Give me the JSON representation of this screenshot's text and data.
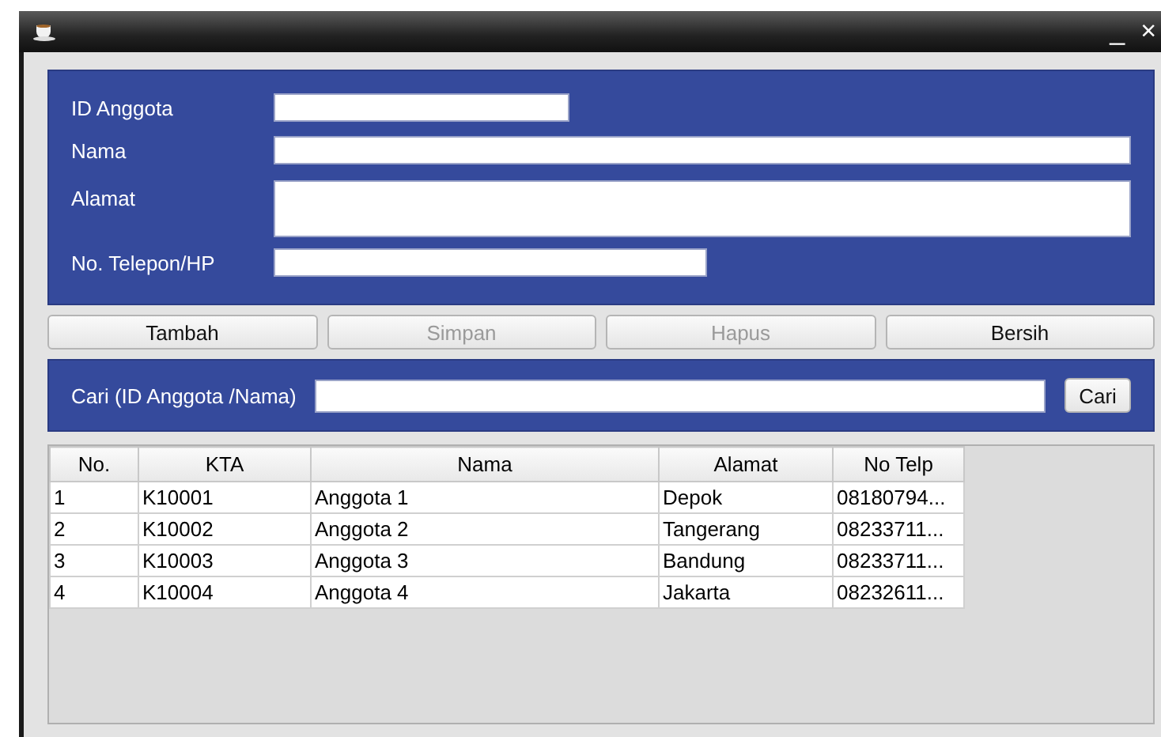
{
  "window": {
    "controls": [
      "_",
      "×"
    ]
  },
  "form": {
    "fields": [
      {
        "kind": "short",
        "label": "ID Anggota"
      },
      {
        "kind": "long",
        "label": "Nama"
      },
      {
        "kind": "area",
        "label": "Alamat"
      },
      {
        "kind": "medium",
        "label": "No. Telepon/HP"
      }
    ]
  },
  "buttons": [
    {
      "label": "Tambah",
      "disabled": false
    },
    {
      "label": "Simpan",
      "disabled": true
    },
    {
      "label": "Hapus",
      "disabled": true
    },
    {
      "label": "Bersih",
      "disabled": false
    }
  ],
  "search": {
    "label": "Cari (ID Anggota /Nama)",
    "button": "Cari"
  },
  "table": {
    "columns": [
      "No.",
      "KTA",
      "Nama",
      "Alamat",
      "No Telp"
    ],
    "rows": [
      [
        "1",
        "K10001",
        "Anggota 1",
        "Depok",
        "08180794..."
      ],
      [
        "2",
        "K10002",
        "Anggota 2",
        "Tangerang",
        "08233711..."
      ],
      [
        "3",
        "K10003",
        "Anggota 3",
        "Bandung",
        "08233711..."
      ],
      [
        "4",
        "K10004",
        "Anggota 4",
        "Jakarta",
        "08232611..."
      ]
    ]
  }
}
